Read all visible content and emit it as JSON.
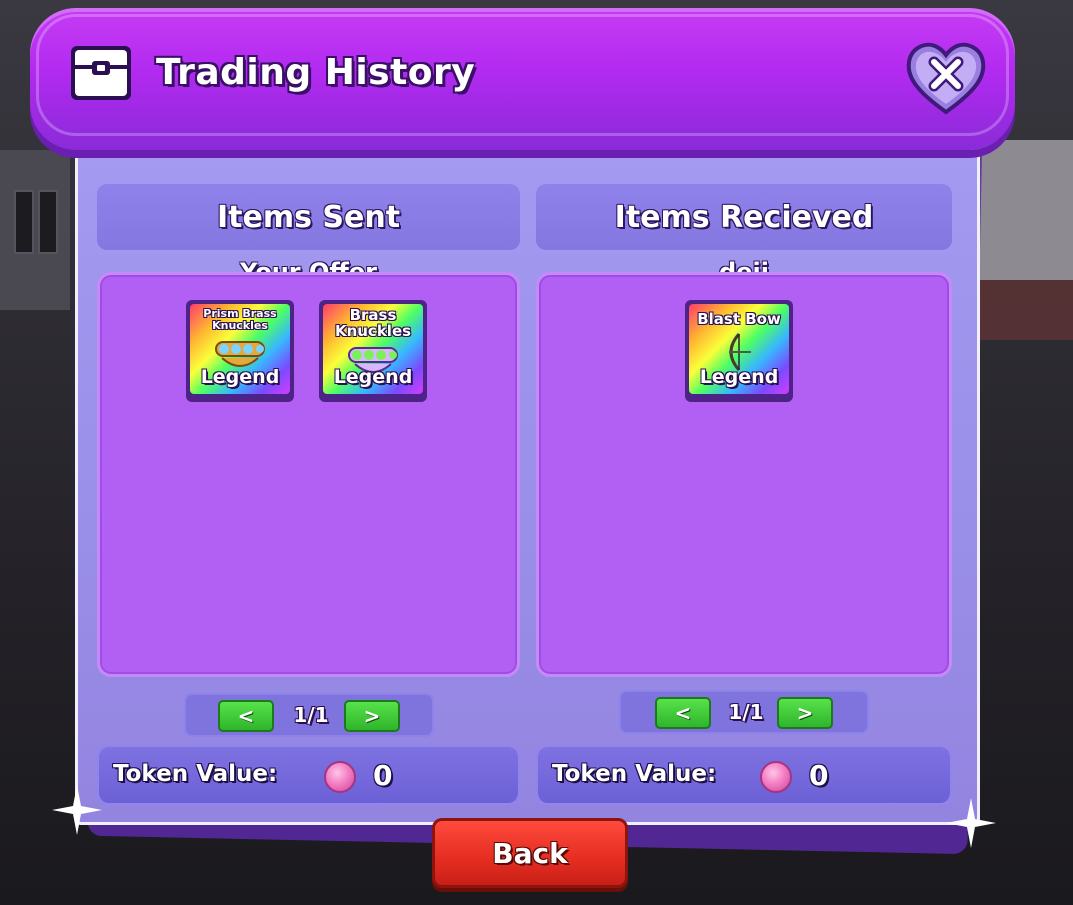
{
  "window": {
    "title": "Trading History",
    "close_icon": "close-x-heart-icon"
  },
  "sent": {
    "header": "Items Sent",
    "owner": "Your Offer",
    "items": [
      {
        "name": "Prism Brass Knuckles",
        "rarity": "Legend"
      },
      {
        "name": "Brass Knuckles",
        "rarity": "Legend"
      }
    ],
    "pager": {
      "prev": "<",
      "page": "1/1",
      "next": ">"
    },
    "token": {
      "label": "Token Value:",
      "value": "0"
    }
  },
  "received": {
    "header": "Items Recieved",
    "owner": "deji",
    "items": [
      {
        "name": "Blast Bow",
        "rarity": "Legend"
      }
    ],
    "pager": {
      "prev": "<",
      "page": "1/1",
      "next": ">"
    },
    "token": {
      "label": "Token Value:",
      "value": "0"
    }
  },
  "footer": {
    "back_label": "Back"
  },
  "colors": {
    "header": "#b22af0",
    "panel": "#998ee8",
    "items_box": "#b25ff3",
    "pager_button": "#2fb52c",
    "back_button": "#e52d22",
    "token_coin": "#f47fc4"
  }
}
